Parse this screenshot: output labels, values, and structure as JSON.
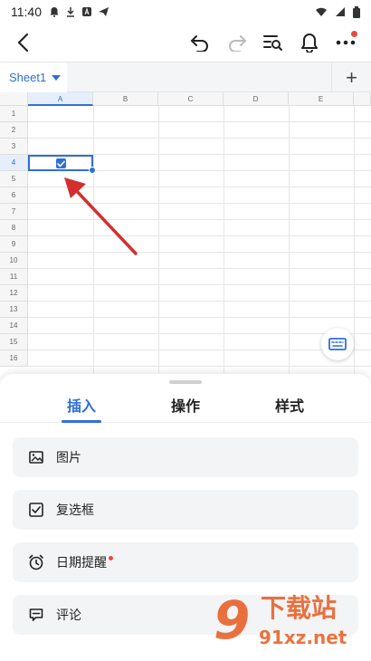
{
  "status_bar": {
    "time": "11:40"
  },
  "sheet": {
    "tab_label": "Sheet1",
    "add_label": "+"
  },
  "grid": {
    "columns": [
      "A",
      "B",
      "C",
      "D",
      "E"
    ],
    "rows": [
      "1",
      "2",
      "3",
      "4",
      "5",
      "6",
      "7",
      "8",
      "9",
      "10",
      "11",
      "12",
      "13",
      "14",
      "15",
      "16"
    ],
    "selected_cell": "A4",
    "selected_cell_value": "checked checkbox"
  },
  "panel": {
    "tabs": [
      {
        "label": "插入",
        "active": true
      },
      {
        "label": "操作",
        "active": false
      },
      {
        "label": "样式",
        "active": false
      }
    ],
    "items": [
      {
        "label": "图片",
        "icon": "image-icon"
      },
      {
        "label": "复选框",
        "icon": "checkbox-icon"
      },
      {
        "label": "日期提醒",
        "icon": "alarm-clock-icon"
      },
      {
        "label": "评论",
        "icon": "comment-icon"
      }
    ]
  },
  "watermark": {
    "logo": "9",
    "text": "下载站",
    "domain": "91xz.net"
  },
  "colors": {
    "accent": "#2f6fd6",
    "annotation_arrow": "#d32f2f",
    "badge": "#e94a3f"
  }
}
